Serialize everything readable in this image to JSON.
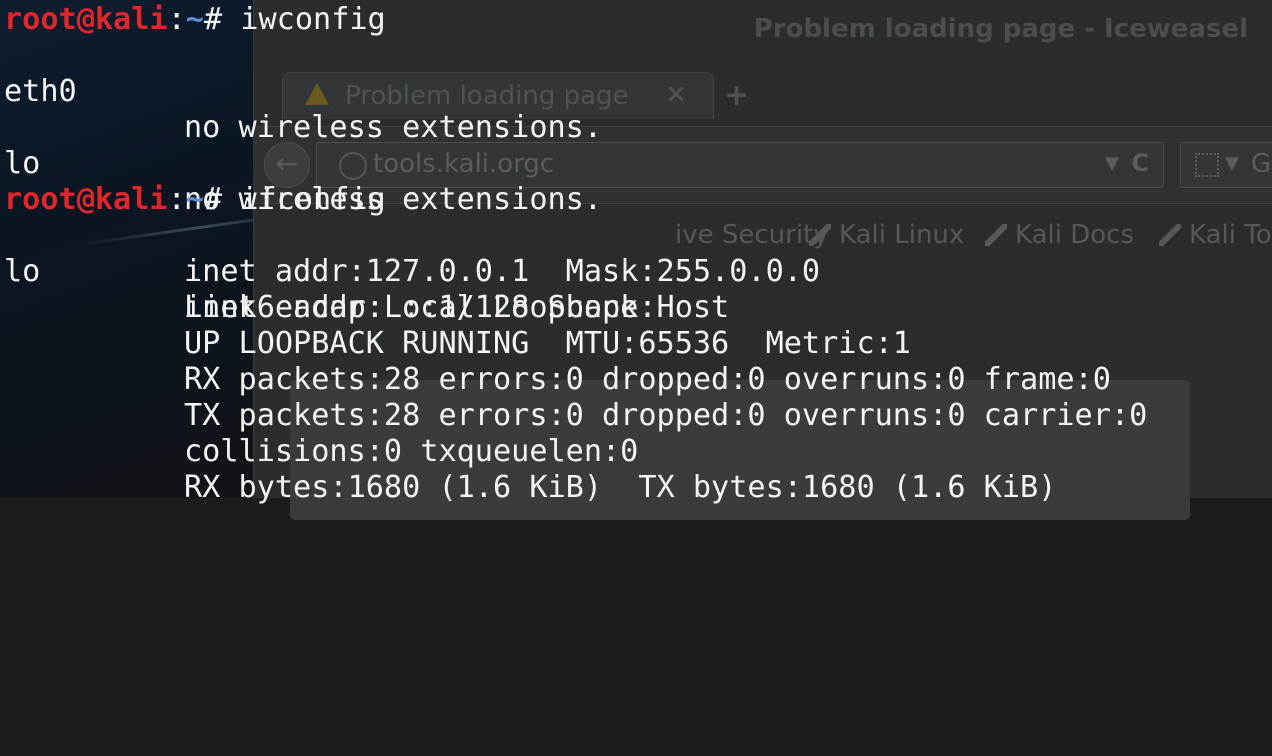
{
  "background_browser": {
    "window_title": "Problem loading page - Iceweasel",
    "tab_title": "Problem loading page",
    "tab_close": "×",
    "new_tab": "+",
    "back_button": "←",
    "url": "tools.kali.orgc",
    "url_dropdown": "▼",
    "reload": "C",
    "search_dropdown": "▼",
    "search_engine": "G",
    "bookmarks": [
      {
        "label": "ive Security"
      },
      {
        "label": "Kali Linux"
      },
      {
        "label": "Kali Docs"
      },
      {
        "label": "Kali To"
      }
    ],
    "colors": {
      "warning": "#6b5a1d"
    }
  },
  "terminal": {
    "colors": {
      "user": "#e0262c",
      "path": "#5a8fd6",
      "text": "#f4f4f4"
    },
    "prompt": {
      "user_host": "root@kali",
      "separator": ":",
      "path": "~",
      "symbol": "#"
    },
    "commands": [
      {
        "text": "iwconfig"
      },
      {
        "text": "ifconfig"
      }
    ],
    "iwconfig_output": [
      {
        "iface": "eth0",
        "detail": "no wireless extensions."
      },
      {
        "iface": "lo",
        "detail": "no wireless extensions."
      }
    ],
    "ifconfig_output": {
      "iface": "lo",
      "lines": [
        "Link encap:Local Loopback",
        "inet addr:127.0.0.1  Mask:255.0.0.0",
        "inet6 addr: ::1/128 Scope:Host",
        "UP LOOPBACK RUNNING  MTU:65536  Metric:1",
        "RX packets:28 errors:0 dropped:0 overruns:0 frame:0",
        "TX packets:28 errors:0 dropped:0 overruns:0 carrier:0",
        "collisions:0 txqueuelen:0",
        "RX bytes:1680 (1.6 KiB)  TX bytes:1680 (1.6 KiB)"
      ]
    }
  }
}
